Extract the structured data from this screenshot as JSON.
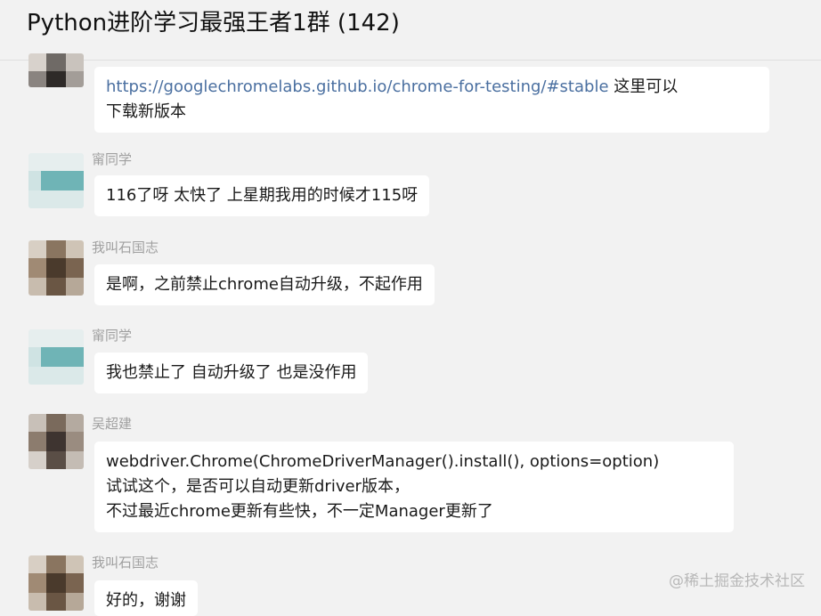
{
  "header": {
    "title": "Python进阶学习最强王者1群 (142)"
  },
  "messages": [
    {
      "sender": "",
      "link": "https://googlechromelabs.github.io/chrome-for-testing/#stable",
      "text_after_link": " 这里可以",
      "line2": "下载新版本"
    },
    {
      "sender": "甯同学",
      "text": "116了呀 太快了 上星期我用的时候才115呀"
    },
    {
      "sender": "我叫石国志",
      "text": "是啊，之前禁止chrome自动升级，不起作用"
    },
    {
      "sender": "甯同学",
      "text": "我也禁止了 自动升级了 也是没作用"
    },
    {
      "sender": "吴超建",
      "lines": [
        "webdriver.Chrome(ChromeDriverManager().install(), options=option)",
        "试试这个，是否可以自动更新driver版本，",
        "不过最近chrome更新有些快，不一定Manager更新了"
      ]
    },
    {
      "sender": "我叫石国志",
      "text": "好的，谢谢"
    }
  ],
  "watermark": "@稀土掘金技术社区",
  "colors": {
    "background": "#f2f2f2",
    "bubble": "#ffffff",
    "link": "#4a6fa0",
    "sender": "#a0a0a0"
  }
}
